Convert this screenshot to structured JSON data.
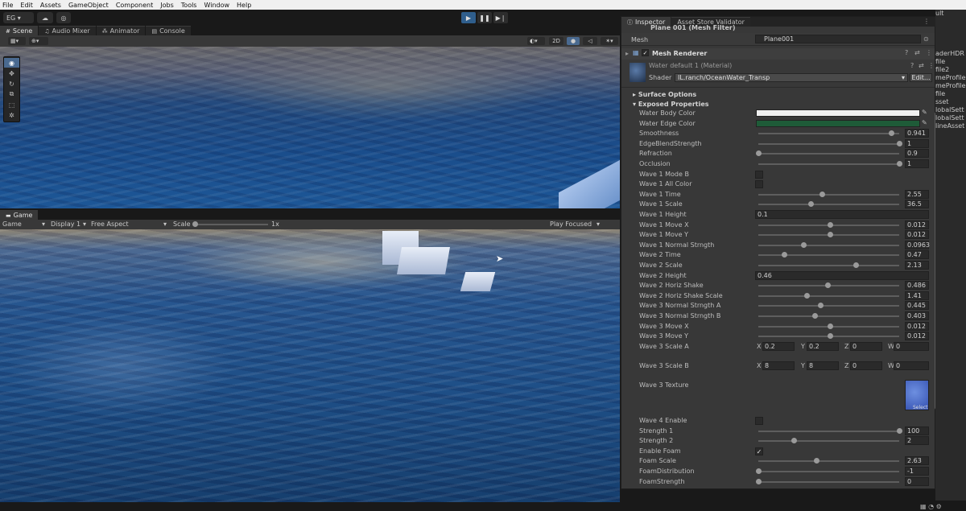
{
  "menubar": [
    "File",
    "Edit",
    "Assets",
    "GameObject",
    "Component",
    "Jobs",
    "Tools",
    "Window",
    "Help"
  ],
  "toolbar": {
    "account": "EG ▾",
    "cloud": "☁",
    "collab": "◎",
    "play": "▶",
    "pause": "❚❚",
    "step": "▶❘"
  },
  "sceneTabs": [
    "Scene",
    "Audio Mixer",
    "Animator",
    "Console"
  ],
  "sceneToolbar": {
    "mode2d": "2D"
  },
  "gameTab": "Game",
  "gameToolbar": {
    "display_mode": "Game",
    "display": "Display 1",
    "aspect": "Free Aspect",
    "scale_label": "Scale",
    "scale_value": "1x",
    "play_mode": "Play Focused"
  },
  "inspector": {
    "tabs": [
      "Inspector",
      "Asset Store Validator"
    ],
    "mesh_filter": "Plane 001 (Mesh Filter)",
    "mesh_label": "Mesh",
    "mesh_value": "Plane001",
    "mesh_renderer": "Mesh Renderer",
    "material": "Water default 1 (Material)",
    "shader_label": "Shader",
    "shader_value": "IL.ranch/OceanWater_Transp",
    "edit_label": "Edit...",
    "surface_options": "Surface Options",
    "exposed_properties": "Exposed Properties",
    "properties": [
      {
        "label": "Water Body Color",
        "kind": "color",
        "color": "#f0f0f0"
      },
      {
        "label": "Water Edge Color",
        "kind": "color",
        "color": "#1e5b38"
      },
      {
        "label": "Smoothness",
        "kind": "slider",
        "value": "0.941",
        "pos": 0.941
      },
      {
        "label": "EdgeBlendStrength",
        "kind": "slider",
        "value": "1",
        "pos": 1
      },
      {
        "label": "Refraction",
        "kind": "slider",
        "value": "0.9",
        "pos": 0
      },
      {
        "label": "Occlusion",
        "kind": "slider",
        "value": "1",
        "pos": 1
      },
      {
        "label": "Wave 1 Mode B",
        "kind": "check",
        "checked": false
      },
      {
        "label": "Wave 1 All Color",
        "kind": "check",
        "checked": false
      },
      {
        "label": "Wave 1 Time",
        "kind": "slider",
        "value": "2.55",
        "pos": 0.45
      },
      {
        "label": "Wave 1 Scale",
        "kind": "slider",
        "value": "36.5",
        "pos": 0.37
      },
      {
        "label": "Wave 1 Height",
        "kind": "field",
        "value": "0.1"
      },
      {
        "label": "Wave 1 Move X",
        "kind": "slider",
        "value": "0.012",
        "pos": 0.51
      },
      {
        "label": "Wave 1 Move Y",
        "kind": "slider",
        "value": "0.012",
        "pos": 0.51
      },
      {
        "label": "Wave 1 Normal Strngth",
        "kind": "slider",
        "value": "0.0963",
        "pos": 0.32
      },
      {
        "label": "Wave 2 Time",
        "kind": "slider",
        "value": "0.47",
        "pos": 0.18
      },
      {
        "label": "Wave 2 Scale",
        "kind": "slider",
        "value": "2.13",
        "pos": 0.69
      },
      {
        "label": "Wave 2 Height",
        "kind": "field",
        "value": "0.46"
      },
      {
        "label": "Wave 2 Horiz Shake",
        "kind": "slider",
        "value": "0.486",
        "pos": 0.49
      },
      {
        "label": "Wave 2 Horiz Shake Scale",
        "kind": "slider",
        "value": "1.41",
        "pos": 0.34
      },
      {
        "label": "Wave 3 Normal Strngth A",
        "kind": "slider",
        "value": "0.445",
        "pos": 0.44
      },
      {
        "label": "Wave 3 Normal Strngth B",
        "kind": "slider",
        "value": "0.403",
        "pos": 0.4
      },
      {
        "label": "Wave 3 Move X",
        "kind": "slider",
        "value": "0.012",
        "pos": 0.51
      },
      {
        "label": "Wave 3 Move Y",
        "kind": "slider",
        "value": "0.012",
        "pos": 0.51
      }
    ],
    "scale_a": {
      "label": "Wave 3 Scale A",
      "x": "0.2",
      "y": "0.2",
      "z": "0",
      "w": "0"
    },
    "scale_b": {
      "label": "Wave 3 Scale B",
      "x": "8",
      "y": "8",
      "z": "0",
      "w": "0"
    },
    "texture": {
      "label": "Wave 3 Texture",
      "select": "Select"
    },
    "properties2": [
      {
        "label": "Wave 4 Enable",
        "kind": "check",
        "checked": false
      },
      {
        "label": "Strength 1",
        "kind": "slider",
        "value": "100",
        "pos": 1
      },
      {
        "label": "Strength 2",
        "kind": "slider",
        "value": "2",
        "pos": 0.25
      },
      {
        "label": "Enable Foam",
        "kind": "check",
        "checked": true
      },
      {
        "label": "Foam Scale",
        "kind": "slider",
        "value": "2.63",
        "pos": 0.41
      },
      {
        "label": "FoamDistribution",
        "kind": "slider",
        "value": "-1",
        "pos": 0
      },
      {
        "label": "FoamStrength",
        "kind": "slider",
        "value": "0",
        "pos": 0
      }
    ],
    "axis": {
      "x": "X",
      "y": "Y",
      "z": "Z",
      "w": "W"
    }
  },
  "rightPanel": [
    "ult",
    "",
    "",
    "",
    "",
    "aderHDR",
    "file",
    "file2",
    "meProfile",
    "meProfile",
    "file",
    "sset",
    "lobalSett",
    "lobalSett",
    "lineAsset"
  ]
}
